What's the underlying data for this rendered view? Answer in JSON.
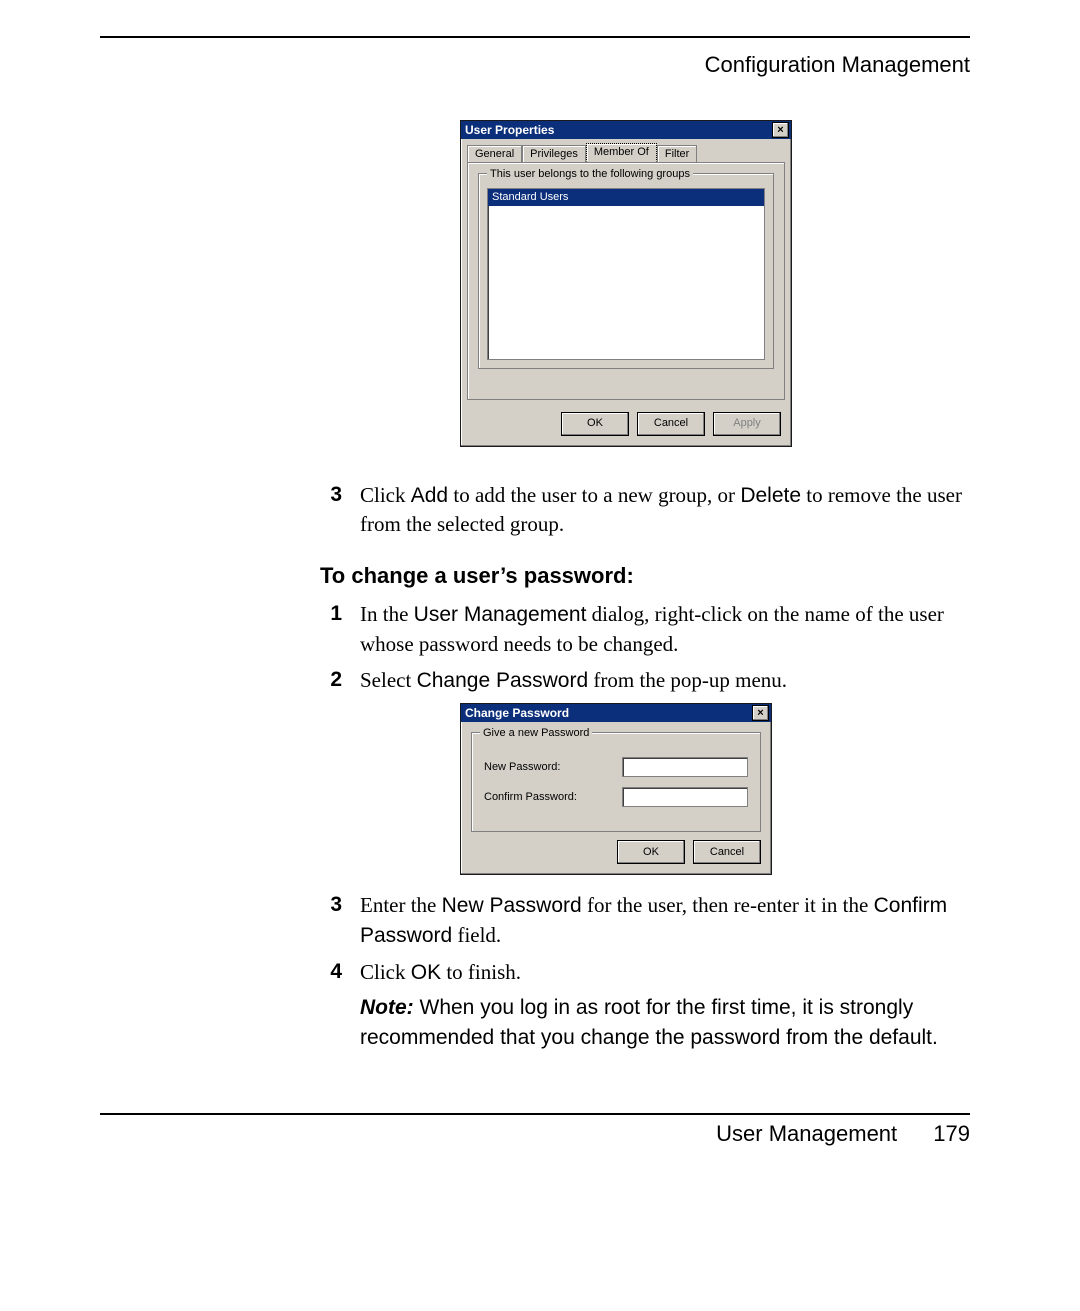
{
  "header": {
    "running_head": "Configuration Management"
  },
  "dialog1": {
    "title": "User Properties",
    "close_glyph": "×",
    "tabs": {
      "general": "General",
      "privileges": "Privileges",
      "member_of": "Member Of",
      "filter": "Filter"
    },
    "group_legend": "This user belongs to the following groups",
    "selected_item": "Standard Users",
    "buttons": {
      "ok": "OK",
      "cancel": "Cancel",
      "apply": "Apply"
    }
  },
  "step_a3": {
    "num": "3",
    "pre": "Click ",
    "add": "Add",
    "mid": " to add the user to a new group, or ",
    "del": "Delete",
    "post": " to remove the user from the selected group."
  },
  "heading_pw": "To change a user’s password:",
  "step_b1": {
    "num": "1",
    "pre": "In the ",
    "um": "User Management",
    "post": " dialog, right-click on the name of the user whose password needs to be changed."
  },
  "step_b2": {
    "num": "2",
    "pre": "Select ",
    "cp": "Change Password",
    "post": " from the pop-up menu."
  },
  "dialog2": {
    "title": "Change Password",
    "close_glyph": "×",
    "group_legend": "Give a new Password",
    "new_pw_label": "New Password:",
    "confirm_pw_label": "Confirm Password:",
    "buttons": {
      "ok": "OK",
      "cancel": "Cancel"
    }
  },
  "step_b3": {
    "num": "3",
    "pre": "Enter the ",
    "np": "New Password",
    "mid": " for the user, then re-enter it in the ",
    "cp": "Confirm Password",
    "post": " field."
  },
  "step_b4": {
    "num": "4",
    "pre": "Click ",
    "ok": "OK",
    "post": " to finish."
  },
  "note": {
    "label": "Note:",
    "text": " When you log in as root for the first time, it is strongly recommended that you change the password from the default."
  },
  "footer": {
    "section": "User Management",
    "page": "179"
  }
}
